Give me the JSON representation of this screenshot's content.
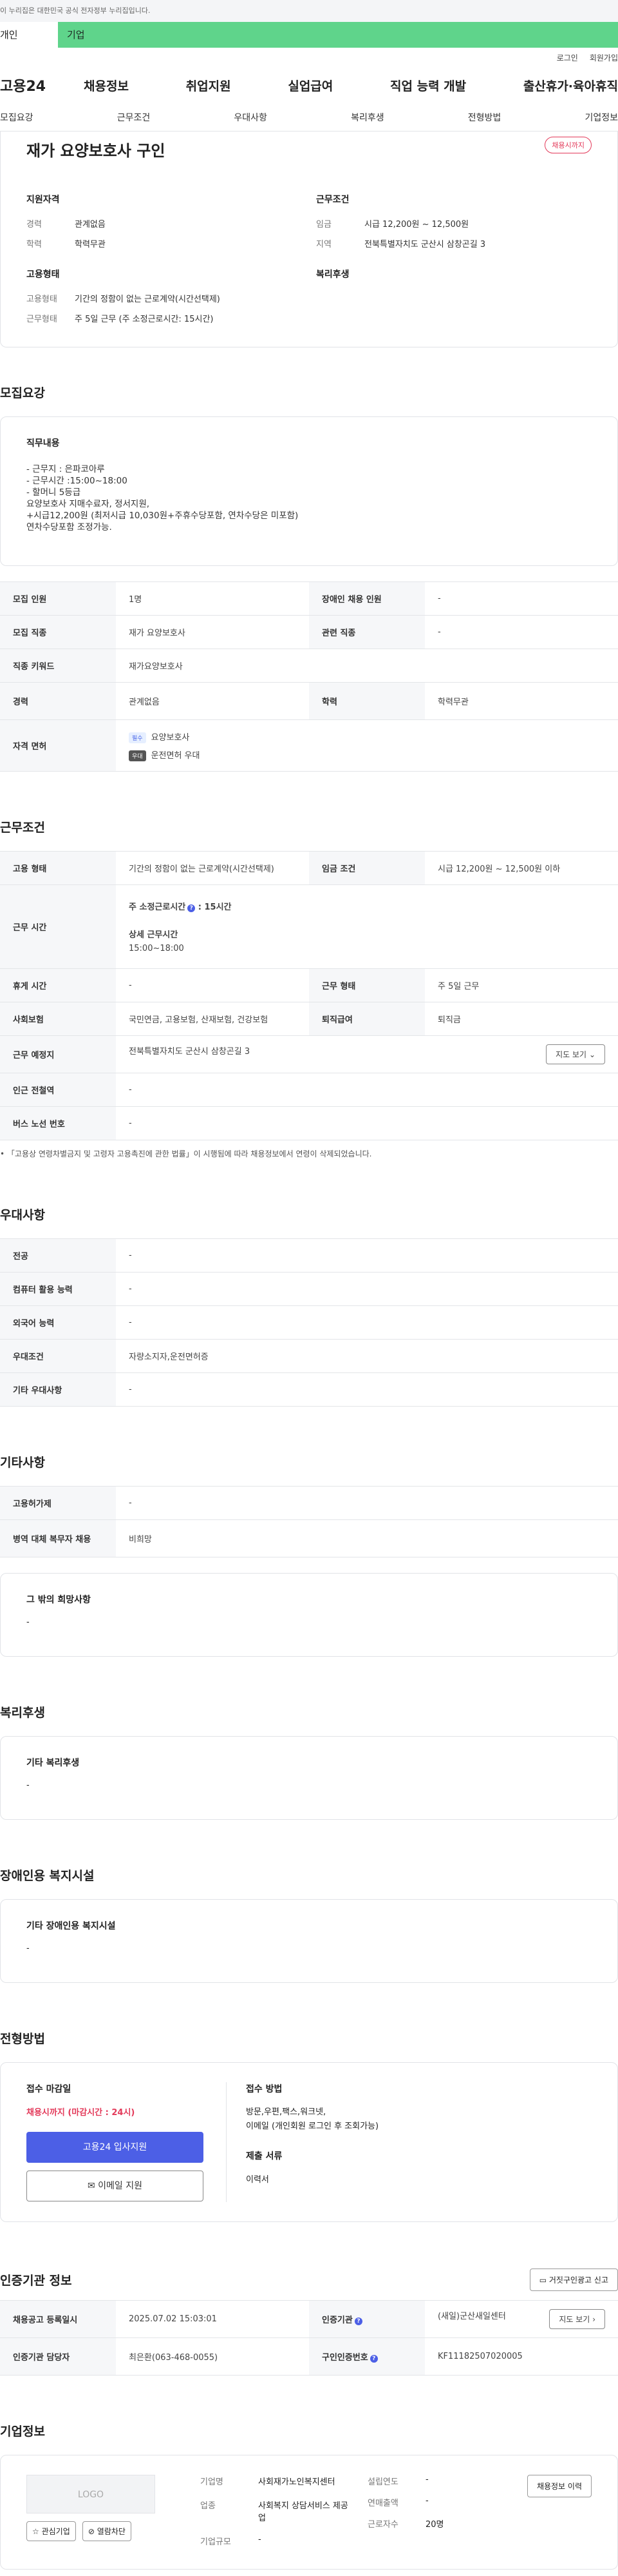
{
  "topbar": {
    "notice": "이 누리집은 대한민국 공식 전자정부 누리집입니다."
  },
  "tabs": {
    "personal": "개인",
    "company": "기업"
  },
  "util": {
    "login": "로그인",
    "signup": "회원가입"
  },
  "gnb": {
    "logo": "고용24",
    "menu": [
      "채용정보",
      "취업지원",
      "실업급여",
      "직업 능력 개발",
      "출산휴가·육아휴직"
    ]
  },
  "subnav": [
    "모집요강",
    "근무조건",
    "우대사항",
    "복리후생",
    "전형방법",
    "기업정보"
  ],
  "summary": {
    "title": "재가 요양보호사 구인",
    "deadline_badge": "채용시까지",
    "qual_heading": "지원자격",
    "career_k": "경력",
    "career_v": "관계없음",
    "edu_k": "학력",
    "edu_v": "학력무관",
    "cond_heading": "근무조건",
    "wage_k": "임금",
    "wage_v": "시급 12,200원 ~ 12,500원",
    "area_k": "지역",
    "area_v": "전북특별자치도 군산시 삼창곤길 3",
    "emp_heading": "고용형태",
    "emptype_k": "고용형태",
    "emptype_v": "기간의 정함이 없는 근로계약(시간선택제)",
    "worktype_k": "근무형태",
    "worktype_v": "주 5일 근무 (주 소정근로시간: 15시간)",
    "welfare_heading": "복리후생"
  },
  "recruit": {
    "section_title": "모집요강",
    "job_heading": "직무내용",
    "job_body": "- 근무지 : 은파코아루\n- 근무시간 :15:00~18:00\n- 할머니 5등급\n요양보호사 지매수료자, 정서지원,\n+시급12,200원 (최저시급 10,030원+주휴수당포함, 연차수당은 미포함)\n연차수당포함 조정가능.",
    "rows": {
      "headcount_k": "모집 인원",
      "headcount_v": "1명",
      "disabled_k": "장애인 채용 인원",
      "disabled_v": "-",
      "job_k": "모집 직종",
      "job_v": "재가 요양보호사",
      "related_k": "관련 직종",
      "related_v": "-",
      "keyword_k": "직종 키워드",
      "keyword_v": "재가요양보호사",
      "career_k": "경력",
      "career_v": "관계없음",
      "edu_k": "학력",
      "edu_v": "학력무관",
      "license_k": "자격 면허",
      "license_req_badge": "필수",
      "license_req": "요양보호사",
      "license_pref_badge": "우대",
      "license_pref": "운전면허 우대"
    }
  },
  "conditions": {
    "section_title": "근무조건",
    "emptype_k": "고용 형태",
    "emptype_v": "기간의 정함이 없는 근로계약(시간선택제)",
    "wage_k": "임금 조건",
    "wage_v": "시급 12,200원 ~ 12,500원 이하",
    "hours_k": "근무 시간",
    "hours_week_label": "주 소정근로시간",
    "hours_week_v": ": 15시간",
    "hours_detail_label": "상세 근무시간",
    "hours_detail_v": "15:00~18:00",
    "rest_k": "휴게 시간",
    "rest_v": "-",
    "form_k": "근무 형태",
    "form_v": "주 5일 근무",
    "insurance_k": "사회보험",
    "insurance_v": "국민연금, 고용보험, 산재보험, 건강보험",
    "severance_k": "퇴직급여",
    "severance_v": "퇴직금",
    "place_k": "근무 예정지",
    "place_v": "전북특별자치도 군산시 삼창곤길 3",
    "map_btn": "지도 보기",
    "station_k": "인근 전철역",
    "station_v": "-",
    "bus_k": "버스 노선 번호",
    "bus_v": "-",
    "note": "「고용상 연령차별금지 및 고령자 고용촉진에 관한 법률」이 시행됨에 따라 채용정보에서 연령이 삭제되었습니다."
  },
  "prefer": {
    "section_title": "우대사항",
    "major_k": "전공",
    "major_v": "-",
    "pc_k": "컴퓨터 활용 능력",
    "pc_v": "-",
    "lang_k": "외국어 능력",
    "lang_v": "-",
    "cond_k": "우대조건",
    "cond_v": "자량소지자,운전면허증",
    "etc_k": "기타 우대사항",
    "etc_v": "-"
  },
  "other": {
    "section_title": "기타사항",
    "insurance_k": "고용허가제",
    "insurance_v": "-",
    "military_k": "병역 대체 복무자 채용",
    "military_v": "비희망",
    "wish_heading": "그 밖의 희망사항",
    "wish_v": "-"
  },
  "welfare": {
    "section_title": "복리후생",
    "heading": "기타 복리후생",
    "value": "-"
  },
  "disabled": {
    "section_title": "장애인용 복지시설",
    "heading": "기타 장애인용 복지시설",
    "value": "-"
  },
  "process": {
    "section_title": "전형방법",
    "deadline_heading": "접수 마감일",
    "deadline_v": "채용시까지 (마감시간 : 24시)",
    "apply_btn": "고용24 입사지원",
    "email_btn": "이메일 지원",
    "method_heading": "접수 방법",
    "method_v": "방문,우편,팩스,워크넷,\n이메일 (개인회원 로그인 후 조회가능)",
    "docs_heading": "제출 서류",
    "docs_v": "이력서"
  },
  "cert": {
    "section_title": "인증기관 정보",
    "report_btn": "거짓구인광고 신고",
    "reg_k": "채용공고 등록일시",
    "reg_v": "2025.07.02 15:03:01",
    "agency_k": "인증기관",
    "agency_v": "(새일)군산새일센터",
    "map_btn": "지도 보기",
    "manager_k": "인증기관 담당자",
    "manager_v": "최은환(063-468-0055)",
    "number_k": "구인인증번호",
    "number_v": "KF11182507020005"
  },
  "company": {
    "section_title": "기업정보",
    "logo_text": "LOGO",
    "fav_btn": "관심기업",
    "block_btn": "열람차단",
    "name_k": "기업명",
    "name_v": "사회재가노인복지센터",
    "industry_k": "업종",
    "industry_v": "사회복지 상담서비스 제공업",
    "size_k": "기업규모",
    "size_v": "-",
    "founded_k": "설립연도",
    "founded_v": "-",
    "revenue_k": "연매출액",
    "revenue_v": "-",
    "employees_k": "근로자수",
    "employees_v": "20명",
    "history_btn": "채용정보 이력"
  },
  "colors": {
    "accent": "#4c5fe6",
    "company_tab": "#5fd48b",
    "deadline": "#e33a5a"
  }
}
